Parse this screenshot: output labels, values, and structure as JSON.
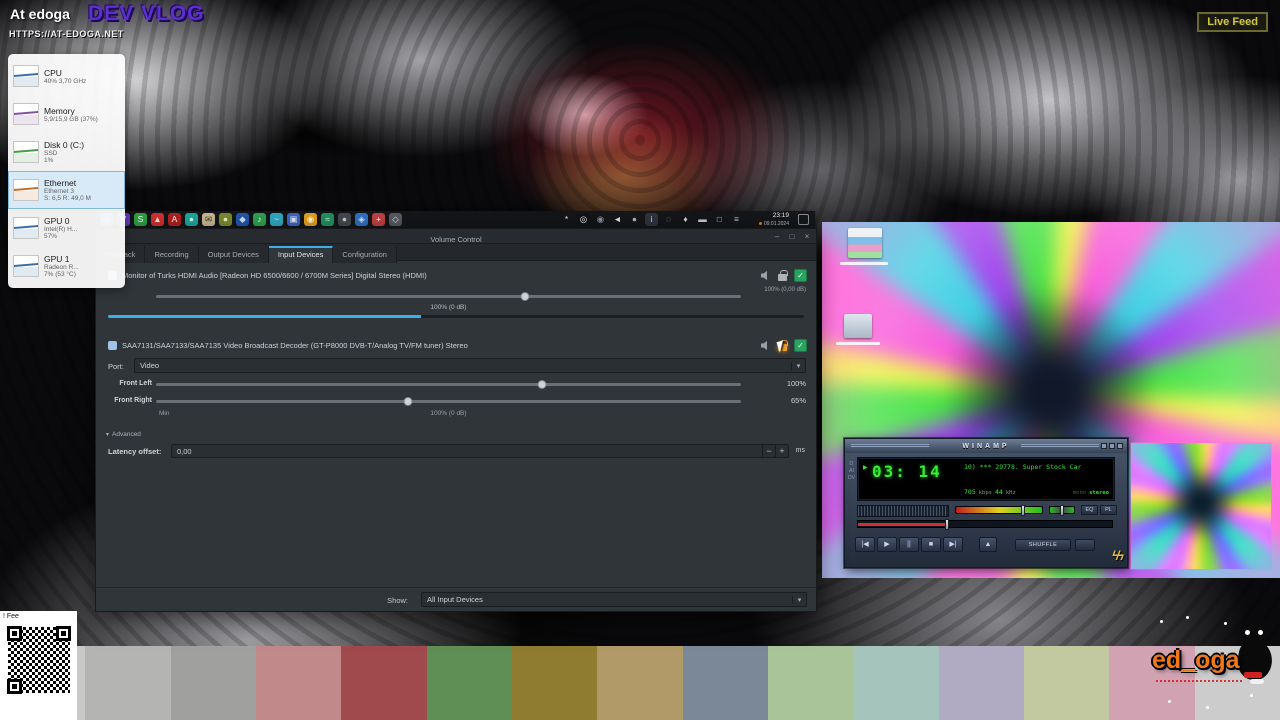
{
  "overlay": {
    "brand": "At edoga",
    "vlog_title": "DEV VLOG",
    "url": "HTTPS://AT-EDOGA.NET",
    "live_badge": "Live Feed",
    "feed_note": "! Fee",
    "logo_text": "ed_oga"
  },
  "system_monitor": {
    "items": [
      {
        "name": "CPU",
        "line1": "40%  3,70 GHz",
        "line2": "",
        "color": "#3b6fa0"
      },
      {
        "name": "Memory",
        "line1": "5,9/15,9 GB (37%)",
        "line2": "",
        "color": "#8252a0"
      },
      {
        "name": "Disk 0 (C:)",
        "line1": "SSD",
        "line2": "1%",
        "color": "#4a9a4a"
      },
      {
        "name": "Ethernet",
        "line1": "Ethernet 3",
        "line2": "S: 6,5  R: 49,0 M",
        "color": "#c07030"
      },
      {
        "name": "GPU 0",
        "line1": "Intel(R) H...",
        "line2": "57%",
        "color": "#3b6fa0"
      },
      {
        "name": "GPU 1",
        "line1": "Radeon R...",
        "line2": "7% (53 °C)",
        "color": "#3b6fa0"
      }
    ]
  },
  "taskbar": {
    "time": "23:19",
    "date": "09.01.2024",
    "left_icons": [
      {
        "g": "◎",
        "c": "#2e6fb0",
        "f": "#cfe4f8"
      },
      {
        "g": "V",
        "c": "#6a3fd0",
        "f": "#ffffff"
      },
      {
        "g": "S",
        "c": "#2f9e44",
        "f": "#ffffff"
      },
      {
        "g": "▲",
        "c": "#d03030",
        "f": "#ffe8d8"
      },
      {
        "g": "A",
        "c": "#b02020",
        "f": "#ffffff"
      },
      {
        "g": "●",
        "c": "#18a89a",
        "f": "#d8f6f2"
      },
      {
        "g": "✉",
        "c": "#c8b890",
        "f": "#403820"
      },
      {
        "g": "●",
        "c": "#7a8a30",
        "f": "#eef4c0"
      },
      {
        "g": "◆",
        "c": "#2255aa",
        "f": "#cfe0f8"
      },
      {
        "g": "♪",
        "c": "#30a050",
        "f": "#ffffff"
      },
      {
        "g": "~",
        "c": "#30a8c0",
        "f": "#ffffff"
      },
      {
        "g": "▣",
        "c": "#3a66c0",
        "f": "#dce8fa"
      },
      {
        "g": "◉",
        "c": "#e0a020",
        "f": "#fff8d8"
      },
      {
        "g": "≈",
        "c": "#209060",
        "f": "#d8f8e8"
      },
      {
        "g": "●",
        "c": "#44484e",
        "f": "#c8ccd2"
      },
      {
        "g": "◈",
        "c": "#3070c0",
        "f": "#d8e8f8"
      },
      {
        "g": "+",
        "c": "#c04040",
        "f": "#ffffff"
      },
      {
        "g": "◇",
        "c": "#555a60",
        "f": "#e0e4ea"
      }
    ],
    "right_icons": [
      {
        "g": "*",
        "f": "#e8e8e8"
      },
      {
        "g": "◎",
        "c": "#111417",
        "f": "#f0f0f0"
      },
      {
        "g": "◉",
        "f": "#8a92a0"
      },
      {
        "g": "◄",
        "f": "#d8dce0"
      },
      {
        "g": "●",
        "f": "#aab2c0"
      },
      {
        "g": "i",
        "c": "#2e3440",
        "f": "#d8dce4"
      },
      {
        "g": "◌",
        "f": "#b0b8c4"
      },
      {
        "g": "♦",
        "f": "#d0d4da"
      },
      {
        "g": "▬",
        "f": "#c6ccd4"
      },
      {
        "g": "□",
        "f": "#c6ccd4"
      },
      {
        "g": "≡",
        "f": "#c0c6ce"
      }
    ]
  },
  "icons": {
    "dropdown_arrow": "▾",
    "expander_arrow": "▾",
    "check": "✓"
  },
  "volume_control": {
    "title": "Volume Control",
    "win_min": "–",
    "win_max": "□",
    "win_close": "×",
    "tabs": [
      "Playback",
      "Recording",
      "Output Devices",
      "Input Devices",
      "Configuration"
    ],
    "device1": {
      "name": "Monitor of Turks HDMI Audio [Radeon HD 6500/6600 / 6700M Series] Digital Stereo (HDMI)",
      "corner_value": "100% (0,00 dB)",
      "volume_label": "100% (0 dB)",
      "slider_pos": "63%",
      "meter_width": "45%"
    },
    "device2": {
      "name": "SAA7131/SAA7133/SAA7135 Video Broadcast Decoder (GT-P8000 DVB-T/Analog TV/FM tuner) Stereo",
      "port_label": "Port:",
      "port_value": "Video",
      "ch1_label": "Front Left",
      "ch1_value": "100%",
      "ch1_pos": "66%",
      "ch2_label": "Front Right",
      "ch2_value": "65%",
      "ch2_pos": "43%",
      "scale_min": "Min",
      "scale_center": "100% (0 dB)",
      "advanced_label": "Advanced",
      "latency_label": "Latency offset:",
      "latency_value": "0,00",
      "latency_unit": "ms",
      "spin_minus": "−",
      "spin_plus": "+"
    },
    "show_label": "Show:",
    "show_value": "All Input Devices",
    "accent": "#3daee9"
  },
  "winamp": {
    "title": "WINAMP",
    "time": "03: 14",
    "track": "10) *** 29778. Super Stock Car",
    "bitrate": "705",
    "bitrate_unit": "kbps",
    "samplerate": "44",
    "samplerate_unit": "kHz",
    "mono": "mono",
    "stereo": "stereo",
    "clutter": "OAIDV",
    "eq": "EQ",
    "pl": "PL",
    "shuffle": "SHUFFLE",
    "btn_prev": "|◀",
    "btn_play": "▶",
    "btn_pause": "||",
    "btn_stop": "■",
    "btn_next": "▶|",
    "btn_eject": "▲",
    "logo_bolt": "ϟϟ",
    "play_indicator": "▶",
    "volume_pos": "78%",
    "balance_pos": "50%",
    "seek_pos": "35%"
  },
  "color_bars": [
    {
      "c": "#c8c8c6"
    },
    {
      "c": "#b4b4b2"
    },
    {
      "c": "#a0a09e"
    },
    {
      "c": "#c2898b"
    },
    {
      "c": "#a04a4e"
    },
    {
      "c": "#5f8f55"
    },
    {
      "c": "#8f7c30"
    },
    {
      "c": "#b29a68"
    },
    {
      "c": "#7a8898"
    },
    {
      "c": "#aac49a"
    },
    {
      "c": "#a5c4bc"
    },
    {
      "c": "#b0aac2"
    },
    {
      "c": "#c2c8a0"
    },
    {
      "c": "#d0a2b2"
    },
    {
      "c": "#cccccc"
    }
  ]
}
